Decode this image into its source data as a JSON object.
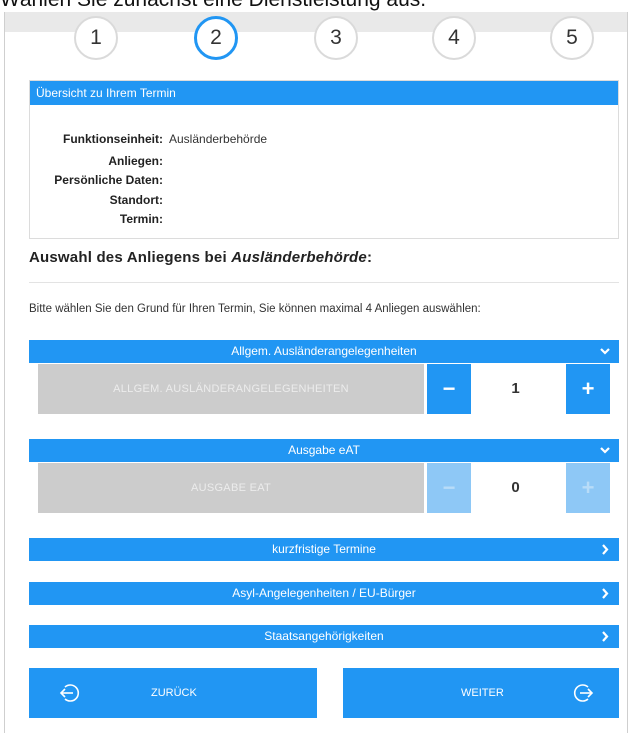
{
  "heading": "Wählen Sie zunächst eine Dienstleistung aus.",
  "steps": [
    "1",
    "2",
    "3",
    "4",
    "5"
  ],
  "active_step": "2",
  "overview": {
    "title": "Übersicht zu Ihrem Termin",
    "rows": [
      {
        "label": "Funktionseinheit:",
        "value": "Ausländerbehörde"
      },
      {
        "label": "Anliegen:",
        "value": ""
      },
      {
        "label": "Persönliche Daten:",
        "value": ""
      },
      {
        "label": "Standort:",
        "value": ""
      },
      {
        "label": "Termin:",
        "value": ""
      }
    ]
  },
  "section": {
    "title_prefix": "Auswahl des Anliegens bei ",
    "title_emph": "Ausländerbehörde",
    "title_suffix": ":",
    "instruction": "Bitte wählen Sie den Grund für Ihren Termin, Sie können maximal 4 Anliegen auswählen:"
  },
  "categories": [
    {
      "label": "Allgem. Ausländerangelegenheiten",
      "expanded": true,
      "service": {
        "label": "ALLGEM. AUSLÄNDERANGELEGENHEITEN",
        "quantity": "1",
        "minus": "−",
        "plus": "+",
        "enabled": true
      }
    },
    {
      "label": "Ausgabe eAT",
      "expanded": true,
      "service": {
        "label": "AUSGABE EAT",
        "quantity": "0",
        "minus": "−",
        "plus": "+",
        "enabled": false
      }
    },
    {
      "label": "kurzfristige Termine",
      "expanded": false
    },
    {
      "label": "Asyl-Angelegenheiten / EU-Bürger",
      "expanded": false
    },
    {
      "label": "Staatsangehörigkeiten",
      "expanded": false
    }
  ],
  "nav": {
    "back_label": "ZURÜCK",
    "next_label": "WEITER"
  },
  "colors": {
    "accent": "#2196f3",
    "disabled_accent": "#8ec8f6",
    "service_bg": "#cccccc"
  },
  "icons": {
    "expanded": "chevron-down-icon",
    "collapsed": "chevron-right-icon",
    "back": "back-arrow-icon",
    "next": "next-arrow-icon"
  }
}
